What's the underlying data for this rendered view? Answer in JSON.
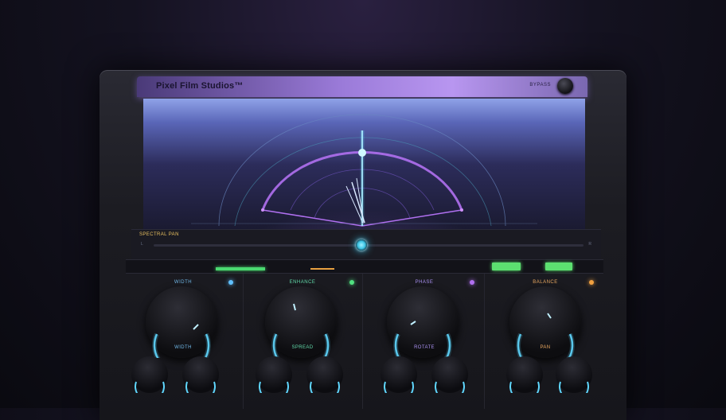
{
  "app": {
    "title": "Pixel Film Studios™",
    "bypass_label": "BYPASS"
  },
  "display": {
    "top_label": "",
    "spectral_label": "SPECTRAL PAN",
    "readout": "",
    "pan_left": "L",
    "pan_right": "R",
    "pan_center": ""
  },
  "status": {
    "left_text": "",
    "mid_text_1": "",
    "mid_text_2": "",
    "right_text": "",
    "btn1": "",
    "btn2": ""
  },
  "colors": {
    "width": "#4ab8f0",
    "enhance": "#5ae0a0",
    "phase": "#9a8af0",
    "balance": "#f0a040"
  },
  "sections": [
    {
      "title": "WIDTH",
      "led": "#60c0ff",
      "caption": "WIDTH",
      "value": "",
      "knobs": [
        {
          "label": "",
          "value": ""
        },
        {
          "label": "",
          "value": ""
        }
      ]
    },
    {
      "title": "ENHANCE",
      "led": "#50e080",
      "caption": "SPREAD",
      "value": "",
      "knobs": [
        {
          "label": "",
          "value": ""
        },
        {
          "label": "",
          "value": ""
        }
      ]
    },
    {
      "title": "PHASE",
      "led": "#b070f0",
      "caption": "ROTATE",
      "value": "",
      "knobs": [
        {
          "label": "",
          "value": ""
        },
        {
          "label": "",
          "value": ""
        }
      ]
    },
    {
      "title": "BALANCE",
      "led": "#f0a040",
      "caption": "PAN",
      "value": "",
      "knobs": [
        {
          "label": "",
          "value": ""
        },
        {
          "label": "",
          "value": ""
        }
      ]
    }
  ]
}
